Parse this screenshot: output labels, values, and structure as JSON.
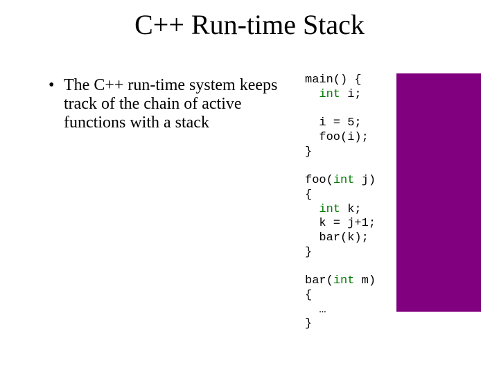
{
  "title": "C++ Run-time Stack",
  "bullet": {
    "dot": "•",
    "text": "The C++ run-time system keeps track of the chain of active functions with a stack"
  },
  "code": {
    "l01a": "main() {",
    "l02a": "  ",
    "l02b": "int",
    "l02c": " i;",
    "blank1": "",
    "l03": "  i = 5;",
    "l04": "  foo(i);",
    "l05": "}",
    "blank2": "",
    "l06a": "foo(",
    "l06b": "int",
    "l06c": " j)",
    "l07": "{",
    "l08a": "  ",
    "l08b": "int",
    "l08c": " k;",
    "l09": "  k = j+1;",
    "l10": "  bar(k);",
    "l11": "}",
    "blank3": "",
    "l12a": "bar(",
    "l12b": "int",
    "l12c": " m)",
    "l13": "{",
    "l14": "  …",
    "l15": "}"
  }
}
